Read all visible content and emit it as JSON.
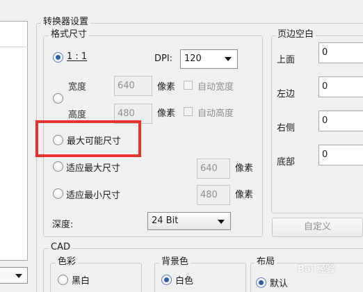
{
  "converter_settings": {
    "title": "转换器设置"
  },
  "format_size": {
    "title": "格式尺寸",
    "ratio_option": {
      "label": "1 : 1",
      "checked": true
    },
    "dpi": {
      "label": "DPI:",
      "value": "120"
    },
    "width": {
      "label": "宽度",
      "value": "640",
      "unit": "像素",
      "auto_label": "自动宽度"
    },
    "height": {
      "label": "高度",
      "value": "480",
      "unit": "像素",
      "auto_label": "自动高度"
    },
    "max_possible": {
      "label": "最大可能尺寸"
    },
    "fit_max": {
      "label": "适应最大尺寸",
      "value": "640",
      "unit": "像素"
    },
    "fit_min": {
      "label": "适应最小尺寸",
      "value": "480",
      "unit": "像素"
    },
    "depth": {
      "label": "深度:",
      "value": "24 Bit"
    }
  },
  "page_margins": {
    "title": "页边空白",
    "top": {
      "label": "上面",
      "value": "0"
    },
    "left": {
      "label": "左边",
      "value": "0"
    },
    "right": {
      "label": "右侧",
      "value": "0"
    },
    "bottom": {
      "label": "底部",
      "value": "0"
    },
    "custom_button": "自定义"
  },
  "cad": {
    "title": "CAD",
    "color": {
      "title": "色彩",
      "option": "黑白"
    },
    "background": {
      "title": "背景色",
      "option": "白色"
    },
    "layout": {
      "title": "布局",
      "option": "默认"
    }
  },
  "watermark": "Bai 经验",
  "colors": {
    "accent": "#2f5fa8",
    "highlight": "#e8332c"
  }
}
